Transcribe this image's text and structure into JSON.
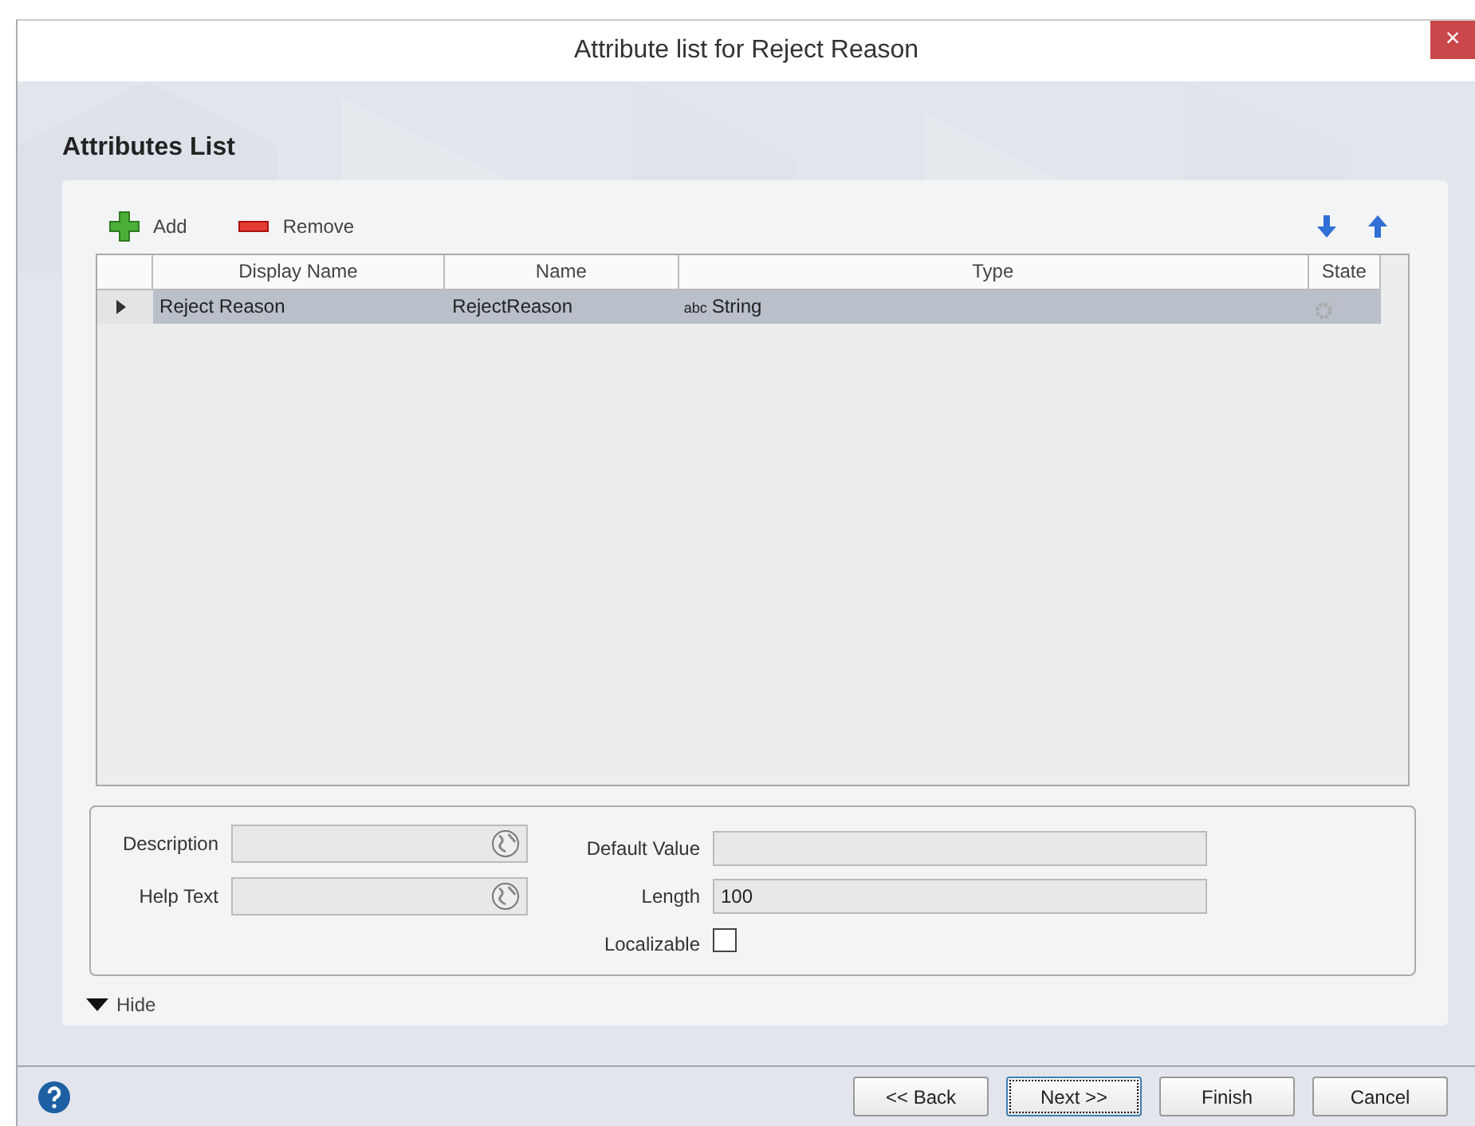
{
  "window": {
    "title": "Attribute list for Reject Reason",
    "close": "×"
  },
  "heading": "Attributes List",
  "toolbar": [
    {
      "kind": "add",
      "label": "Add"
    },
    {
      "kind": "remove",
      "label": "Remove"
    },
    {
      "kind": "down"
    },
    {
      "kind": "up"
    }
  ],
  "table": {
    "columns": [
      "Display Name",
      "Name",
      "Type",
      "State"
    ],
    "rows": [
      {
        "selected": true,
        "display_name": "Reject Reason",
        "name": "RejectReason",
        "type_prefix": "abc",
        "type": "String"
      }
    ]
  },
  "details": {
    "description": {
      "label": "Description"
    },
    "help_text": {
      "label": "Help Text"
    },
    "default_value": {
      "label": "Default Value"
    },
    "length": {
      "label": "Length",
      "value": "100"
    },
    "localizable": {
      "label": "Localizable",
      "checked": false
    }
  },
  "toggle": {
    "label": "Hide",
    "expanded": true
  },
  "buttons": [
    {
      "label": "<< Back",
      "focused": false
    },
    {
      "label": "Next >>",
      "focused": true
    },
    {
      "label": "Finish",
      "focused": false
    },
    {
      "label": "Cancel",
      "focused": false
    }
  ]
}
